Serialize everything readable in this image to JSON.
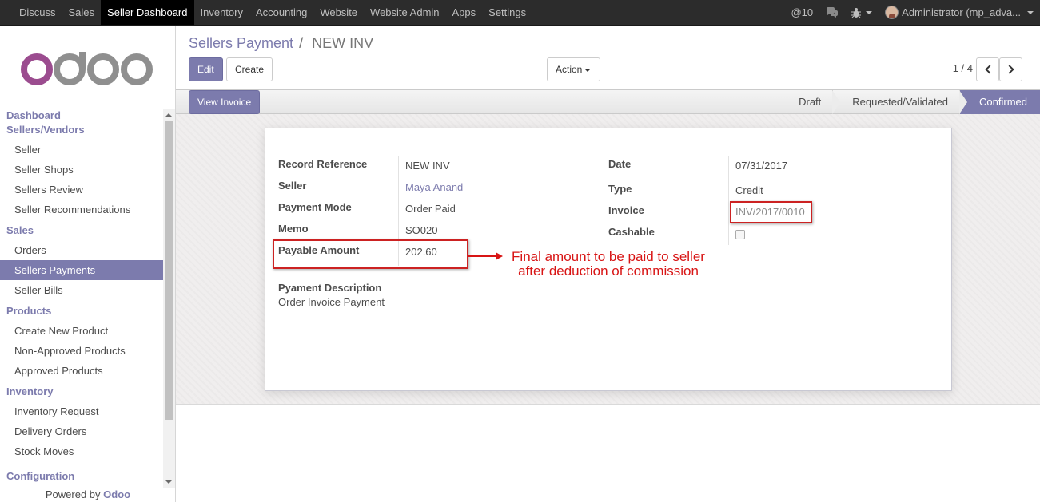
{
  "topbar": {
    "menu": [
      "Discuss",
      "Sales",
      "Seller Dashboard",
      "Inventory",
      "Accounting",
      "Website",
      "Website Admin",
      "Apps",
      "Settings"
    ],
    "active_menu": "Seller Dashboard",
    "messages_count": "@10",
    "user": "Administrator (mp_adva..."
  },
  "sidebar": {
    "sections": [
      {
        "heading": "Dashboard",
        "items": []
      },
      {
        "heading": "Sellers/Vendors",
        "items": [
          "Seller",
          "Seller Shops",
          "Sellers Review",
          "Seller Recommendations"
        ]
      },
      {
        "heading": "Sales",
        "items": [
          "Orders",
          "Sellers Payments",
          "Seller Bills"
        ]
      },
      {
        "heading": "Products",
        "items": [
          "Create New Product",
          "Non-Approved Products",
          "Approved Products"
        ]
      },
      {
        "heading": "Inventory",
        "items": [
          "Inventory Request",
          "Delivery Orders",
          "Stock Moves"
        ]
      },
      {
        "heading": "Configuration",
        "items": []
      }
    ],
    "active_item": "Sellers Payments",
    "powered_prefix": "Powered by",
    "powered_brand": "Odoo"
  },
  "control_panel": {
    "breadcrumb_parent": "Sellers Payment",
    "breadcrumb_sep": "/",
    "breadcrumb_current": "NEW INV",
    "edit_label": "Edit",
    "create_label": "Create",
    "action_label": "Action",
    "pager": "1 / 4"
  },
  "statusbar": {
    "view_invoice_label": "View Invoice",
    "stages": [
      "Draft",
      "Requested/Validated",
      "Confirmed"
    ],
    "active_stage": "Confirmed"
  },
  "form": {
    "left": [
      {
        "label": "Record Reference",
        "value": "NEW INV"
      },
      {
        "label": "Seller",
        "value": "Maya Anand"
      },
      {
        "label": "Payment Mode",
        "value": "Order Paid"
      },
      {
        "label": "Memo",
        "value": "SO020"
      },
      {
        "label": "Payable Amount",
        "value": "202.60"
      }
    ],
    "right": [
      {
        "label": "Date",
        "value": "07/31/2017"
      },
      {
        "label": "Type",
        "value": "Credit"
      },
      {
        "label": "Invoice",
        "value": "INV/2017/0010"
      },
      {
        "label": "Cashable",
        "value": ""
      }
    ],
    "cashable_checked": false,
    "description_label": "Pyament Description",
    "description_value": "Order Invoice Payment"
  },
  "annotation": {
    "line1": "Final amount to be paid to seller",
    "line2": "after deduction of commission",
    "color": "#d81515"
  },
  "colors": {
    "brand": "#7c7bad",
    "topbar": "#2c2c2c"
  }
}
